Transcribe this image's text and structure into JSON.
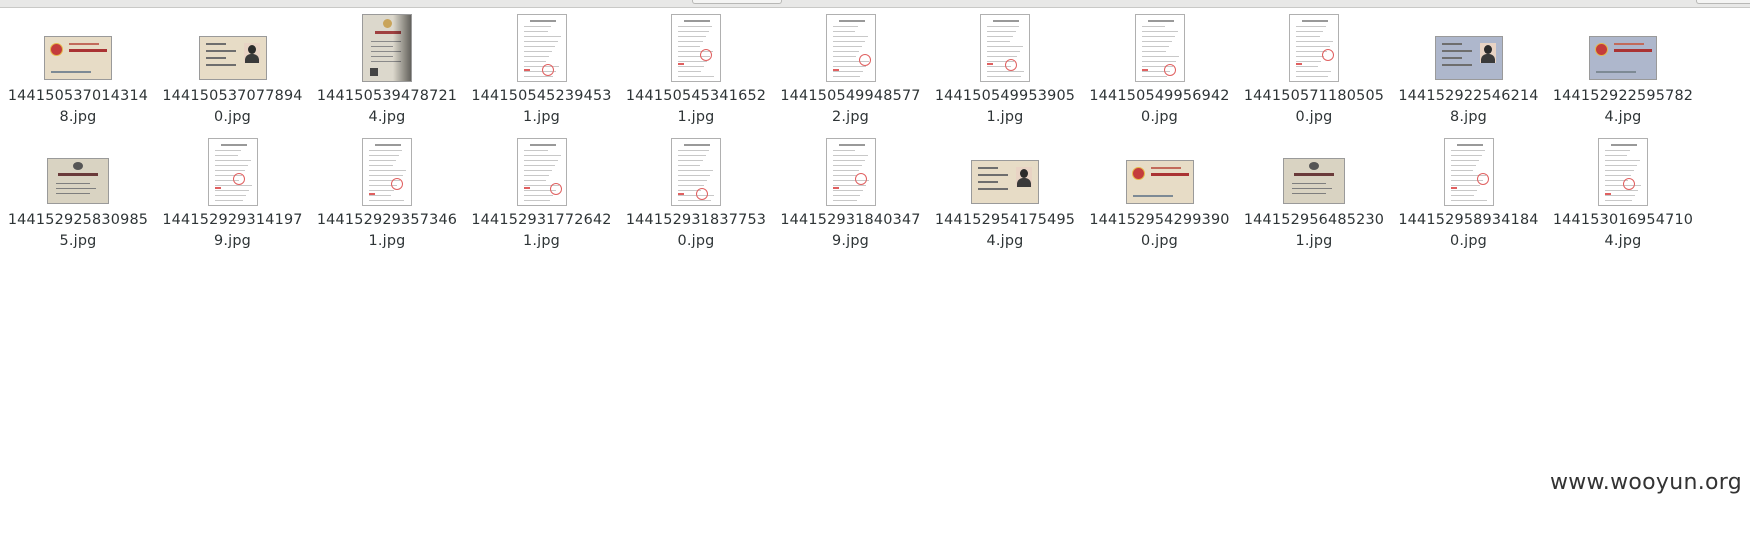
{
  "files": [
    {
      "name": "1441505370143148.jpg",
      "thumb": "id-card-front"
    },
    {
      "name": "1441505370778940.jpg",
      "thumb": "id-card-back"
    },
    {
      "name": "1441505394787214.jpg",
      "thumb": "license-photo"
    },
    {
      "name": "1441505452394531.jpg",
      "thumb": "document"
    },
    {
      "name": "1441505453416521.jpg",
      "thumb": "document"
    },
    {
      "name": "1441505499485772.jpg",
      "thumb": "document"
    },
    {
      "name": "1441505499539051.jpg",
      "thumb": "document"
    },
    {
      "name": "1441505499569420.jpg",
      "thumb": "document"
    },
    {
      "name": "1441505711805050.jpg",
      "thumb": "document"
    },
    {
      "name": "1441529225462148.jpg",
      "thumb": "id-card-back-blue"
    },
    {
      "name": "1441529225957824.jpg",
      "thumb": "id-card-front-blue"
    },
    {
      "name": "1441529258309855.jpg",
      "thumb": "business-license"
    },
    {
      "name": "1441529293141979.jpg",
      "thumb": "document"
    },
    {
      "name": "1441529293573461.jpg",
      "thumb": "document"
    },
    {
      "name": "1441529317726421.jpg",
      "thumb": "document"
    },
    {
      "name": "1441529318377530.jpg",
      "thumb": "document"
    },
    {
      "name": "1441529318403479.jpg",
      "thumb": "document"
    },
    {
      "name": "1441529541754954.jpg",
      "thumb": "id-card-back"
    },
    {
      "name": "1441529542993900.jpg",
      "thumb": "id-card-front"
    },
    {
      "name": "1441529564852301.jpg",
      "thumb": "business-license"
    },
    {
      "name": "1441529589341840.jpg",
      "thumb": "document"
    },
    {
      "name": "1441530169547104.jpg",
      "thumb": "document"
    }
  ],
  "watermark": "www.wooyun.org",
  "colors": {
    "background": "#ffffff",
    "text": "#2e3436",
    "stamp_red": "#e06060",
    "card_beige": "#e7dcc6",
    "card_blue": "#aeb7cc"
  }
}
